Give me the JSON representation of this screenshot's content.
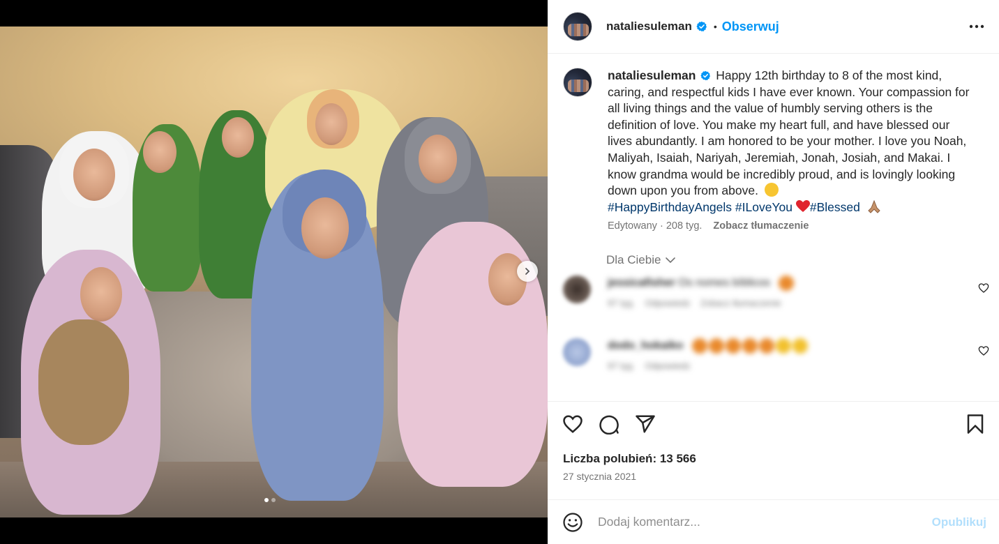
{
  "post": {
    "username": "nataliesuleman",
    "follow_label": "Obserwuj",
    "separator": "•",
    "caption_text": "Happy 12th birthday to 8 of the most kind, caring, and respectful kids I have ever known. Your compassion for all living things and the value of humbly serving others is the definition of love. You make my heart full, and have blessed our lives abundantly. I am honored to be your mother. I love you Noah, Maliyah, Isaiah, Nariyah, Jeremiah, Jonah, Josiah, and Makai. I know grandma would be incredibly proud, and is lovingly looking down upon you from above.",
    "hashtags": [
      "#HappyBirthdayAngels",
      "#ILoveYou",
      "#Blessed"
    ],
    "edited_label": "Edytowany · 208 tyg.",
    "translate_label": "Zobacz tłumaczenie",
    "filter_label": "Dla Ciebie",
    "likes_label": "Liczba polubień: 13 566",
    "date_label": "27 stycznia 2021",
    "comment_placeholder": "Dodaj komentarz...",
    "publish_label": "Opublikuj"
  },
  "comments": [
    {
      "username": "jessicafisher",
      "text": "Os nomes bíblicos",
      "time": "97 tyg.",
      "reply": "Odpowiedz",
      "translate": "Zobacz tłumaczenie"
    },
    {
      "username": "dodo_hokaiko",
      "text": "",
      "time": "97 tyg.",
      "reply": "Odpowiedz"
    }
  ],
  "carousel": {
    "current": 1,
    "total": 2
  },
  "colors": {
    "accent": "#0095f6",
    "verified": "#0095f6",
    "hashtag": "#00376b",
    "heart": "#ed4956",
    "publish_disabled": "#b2dffc"
  },
  "icons": [
    "verified-icon",
    "more-icon",
    "chevron-down-icon",
    "heart-icon",
    "comment-icon",
    "share-icon",
    "bookmark-icon",
    "emoji-icon",
    "next-icon"
  ]
}
